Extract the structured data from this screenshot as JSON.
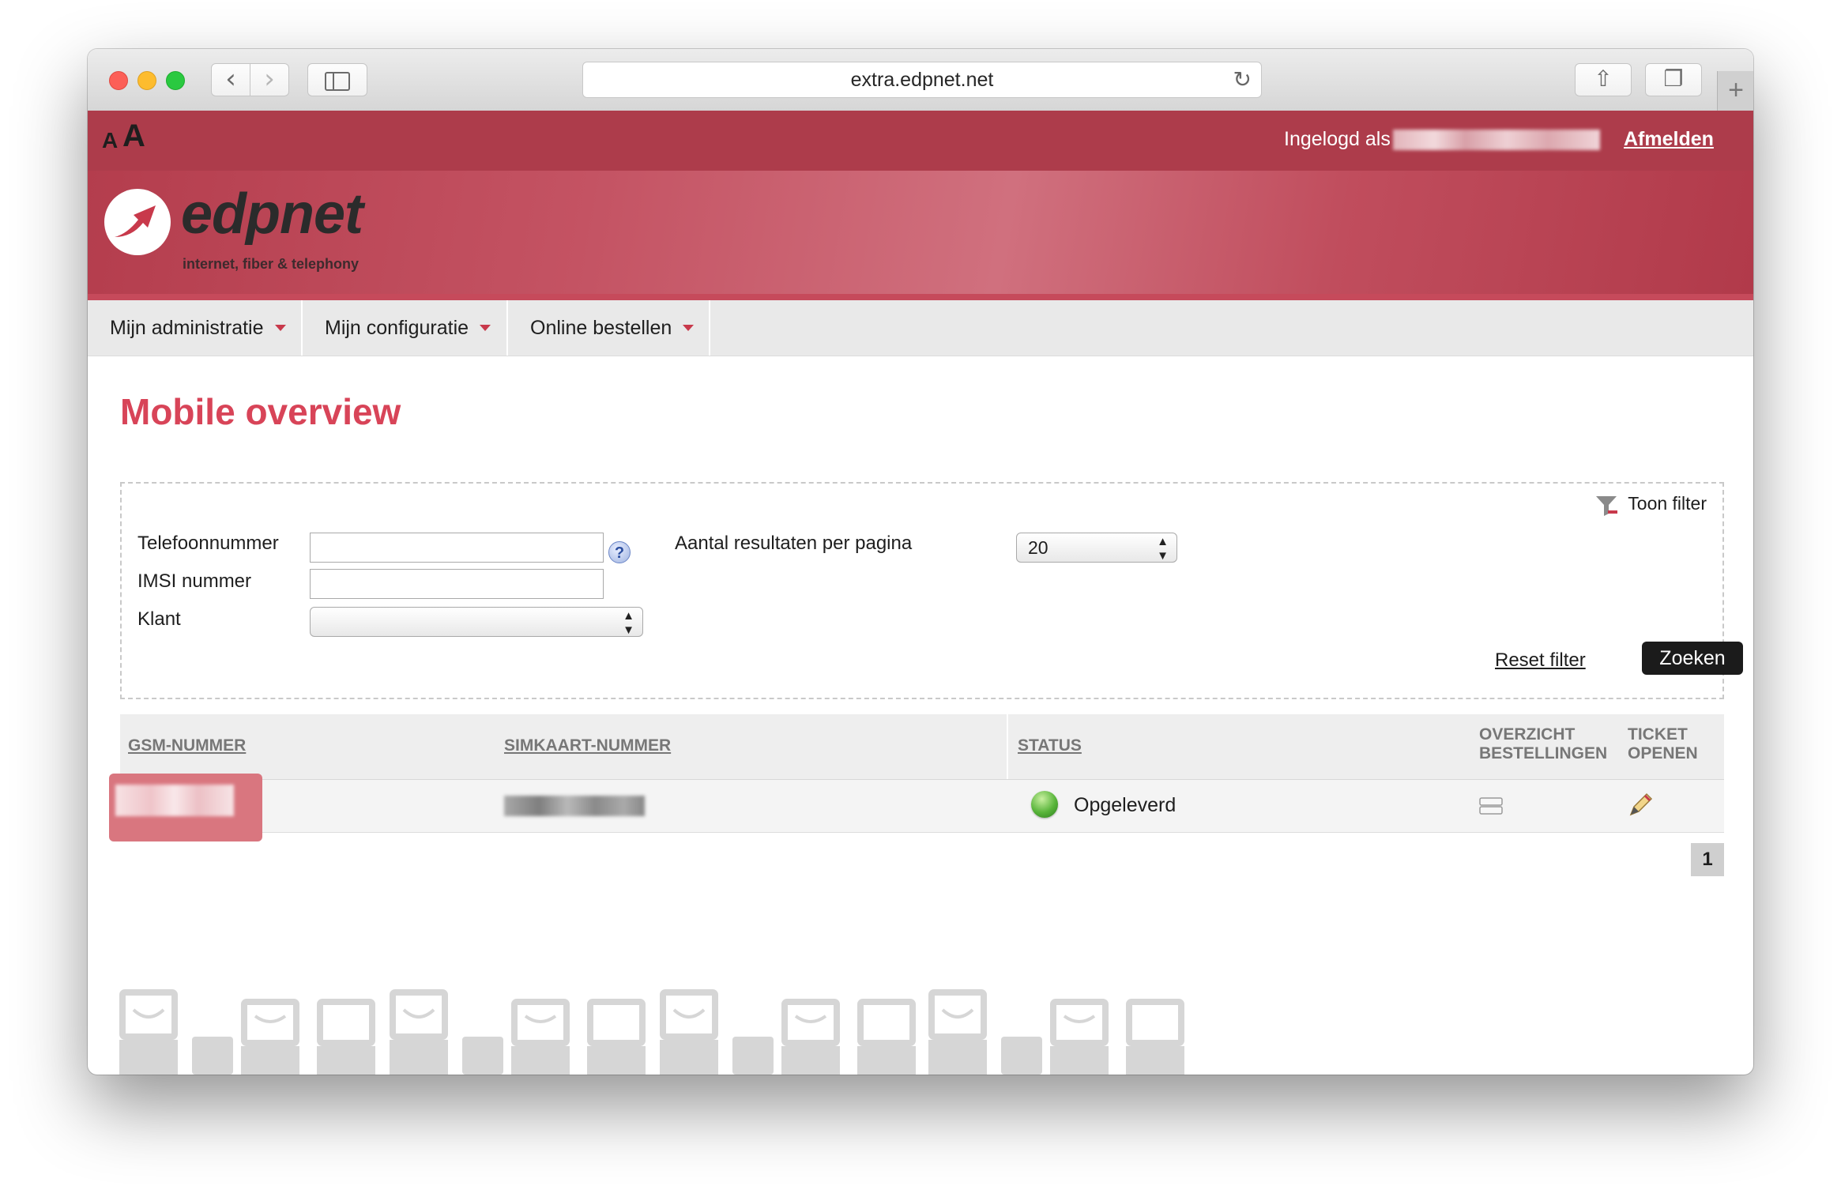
{
  "browser": {
    "url": "extra.edpnet.net",
    "back_glyph": "‹",
    "forward_glyph": "›",
    "reload_glyph": "↻",
    "share_glyph": "⇧",
    "tabs_glyph": "❐",
    "newtab_glyph": "+"
  },
  "topbar": {
    "font_small": "A",
    "font_large": "A",
    "login_label": "Ingelogd als",
    "logout": "Afmelden"
  },
  "brand": {
    "name": "edpnet",
    "tagline": "internet, fiber & telephony"
  },
  "nav": {
    "items": [
      {
        "label": "Mijn administratie"
      },
      {
        "label": "Mijn configuratie"
      },
      {
        "label": "Online bestellen"
      }
    ]
  },
  "page": {
    "title": "Mobile overview"
  },
  "filter": {
    "toggle_label": "Toon filter",
    "phone_label": "Telefoonnummer",
    "phone_value": "",
    "help_glyph": "?",
    "imsi_label": "IMSI nummer",
    "imsi_value": "",
    "customer_label": "Klant",
    "customer_value": "",
    "per_page_label": "Aantal resultaten per pagina",
    "per_page_value": "20",
    "reset_label": "Reset filter",
    "search_label": "Zoeken"
  },
  "table": {
    "columns": {
      "gsm": "GSM-NUMMER",
      "sim": "SIMKAART-NUMMER",
      "status": "STATUS",
      "orders_line1": "OVERZICHT",
      "orders_line2": "BESTELLINGEN",
      "ticket_line1": "TICKET",
      "ticket_line2": "OPENEN"
    },
    "rows": [
      {
        "status": "Opgeleverd",
        "status_color": "#58b43a"
      }
    ]
  },
  "pagination": {
    "current": "1"
  },
  "colors": {
    "brand_red": "#ad3c4b",
    "title_red": "#d84458"
  }
}
